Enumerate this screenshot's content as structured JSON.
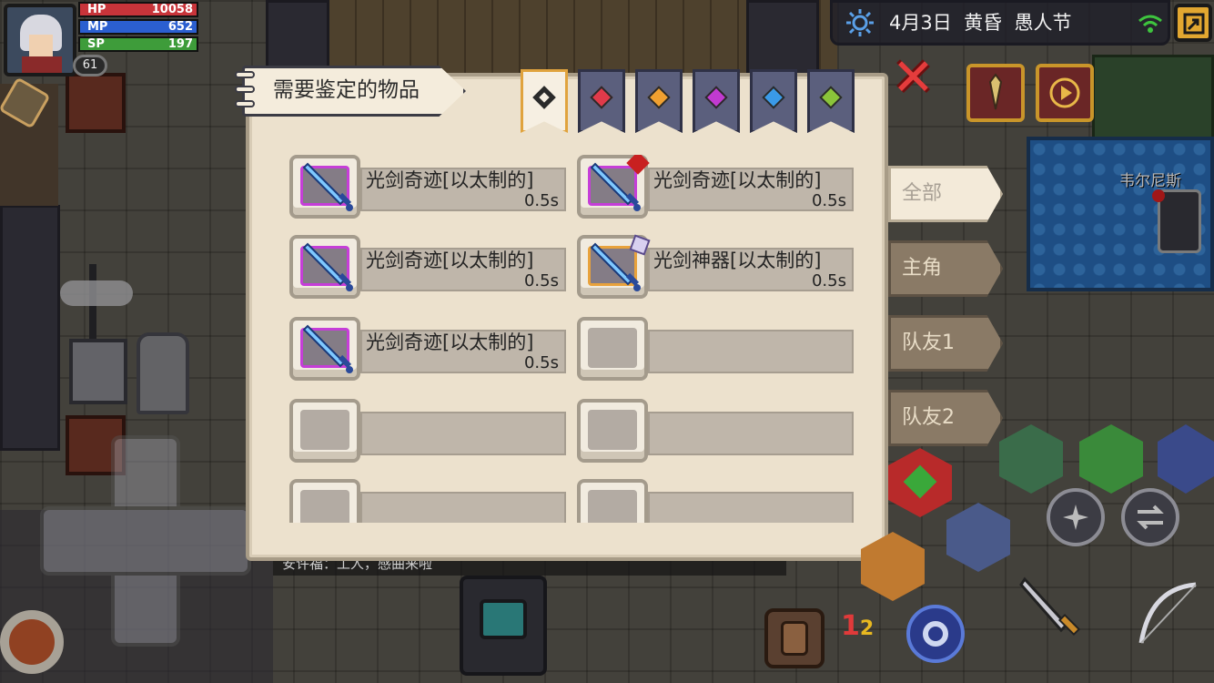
{
  "hud": {
    "level": "61",
    "hp_label": "HP",
    "hp_value": "10058",
    "mp_label": "MP",
    "mp_value": "652",
    "sp_label": "SP",
    "sp_value": "197"
  },
  "status_bar": {
    "date": "4月3日",
    "time_of_day": "黄昏",
    "holiday": "愚人节",
    "weather_icon": "sun-icon",
    "signal_icon": "wifi-icon"
  },
  "world": {
    "location_label": "韦尔尼斯",
    "chat_text": "安许福：工人，感曲来啦"
  },
  "panel": {
    "title": "需要鉴定的物品",
    "filter_tabs": [
      {
        "id": "all",
        "gem_color": "#2a2a2a",
        "active": true
      },
      {
        "id": "red",
        "gem_color": "#e03a4a",
        "active": false
      },
      {
        "id": "orange",
        "gem_color": "#f0a030",
        "active": false
      },
      {
        "id": "purple",
        "gem_color": "#c13ad0",
        "active": false
      },
      {
        "id": "blue",
        "gem_color": "#3a9ae8",
        "active": false
      },
      {
        "id": "green",
        "gem_color": "#8ac43a",
        "active": false
      }
    ],
    "items": [
      {
        "name": "光剑奇迹[以太制的]",
        "time": "0.5s",
        "rarity": "purple",
        "icon": "light-sword-icon",
        "badge": ""
      },
      {
        "name": "光剑奇迹[以太制的]",
        "time": "0.5s",
        "rarity": "purple",
        "icon": "light-sword-icon",
        "badge": "red-mark-icon"
      },
      {
        "name": "光剑奇迹[以太制的]",
        "time": "0.5s",
        "rarity": "purple",
        "icon": "light-sword-icon",
        "badge": ""
      },
      {
        "name": "光剑神器[以太制的]",
        "time": "0.5s",
        "rarity": "orange",
        "icon": "light-sword-icon",
        "badge": "crystal-icon"
      },
      {
        "name": "光剑奇迹[以太制的]",
        "time": "0.5s",
        "rarity": "purple",
        "icon": "light-sword-icon",
        "badge": ""
      },
      {
        "name": "",
        "time": "",
        "rarity": "empty",
        "icon": "",
        "badge": ""
      },
      {
        "name": "",
        "time": "",
        "rarity": "empty",
        "icon": "",
        "badge": ""
      },
      {
        "name": "",
        "time": "",
        "rarity": "empty",
        "icon": "",
        "badge": ""
      },
      {
        "name": "",
        "time": "",
        "rarity": "empty",
        "icon": "",
        "badge": ""
      },
      {
        "name": "",
        "time": "",
        "rarity": "empty",
        "icon": "",
        "badge": ""
      }
    ],
    "side_tabs": [
      "全部",
      "主角",
      "队友1",
      "队友2"
    ],
    "close_icon": "close-x-icon"
  },
  "colors": {
    "rarity_purple": "#c53ed8",
    "rarity_orange": "#e8a23c",
    "panel_bg": "#ece1cd",
    "hp": "#c8343a",
    "mp": "#2b5fd0",
    "sp": "#3e9c3a"
  }
}
